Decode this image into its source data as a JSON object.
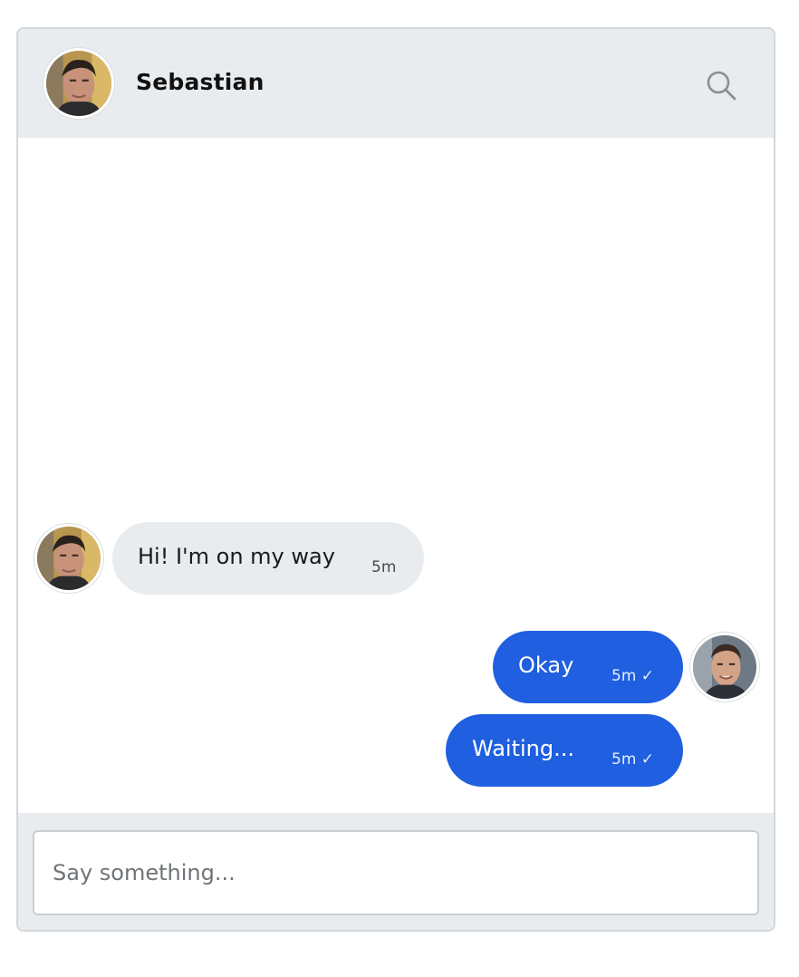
{
  "header": {
    "contact_name": "Sebastian",
    "avatar_icon": "contact-avatar",
    "search_icon": "search-icon"
  },
  "messages": [
    {
      "direction": "incoming",
      "text": "Hi! I'm on my way",
      "time": "5m"
    },
    {
      "direction": "outgoing",
      "text": "Okay",
      "time": "5m ✓"
    },
    {
      "direction": "outgoing",
      "text": "Waiting...",
      "time": "5m ✓"
    }
  ],
  "composer": {
    "placeholder": "Say something...",
    "value": ""
  },
  "colors": {
    "header_bg": "#e8ecef",
    "incoming_bubble": "#e8ecef",
    "outgoing_bubble": "#1f5fe0"
  }
}
